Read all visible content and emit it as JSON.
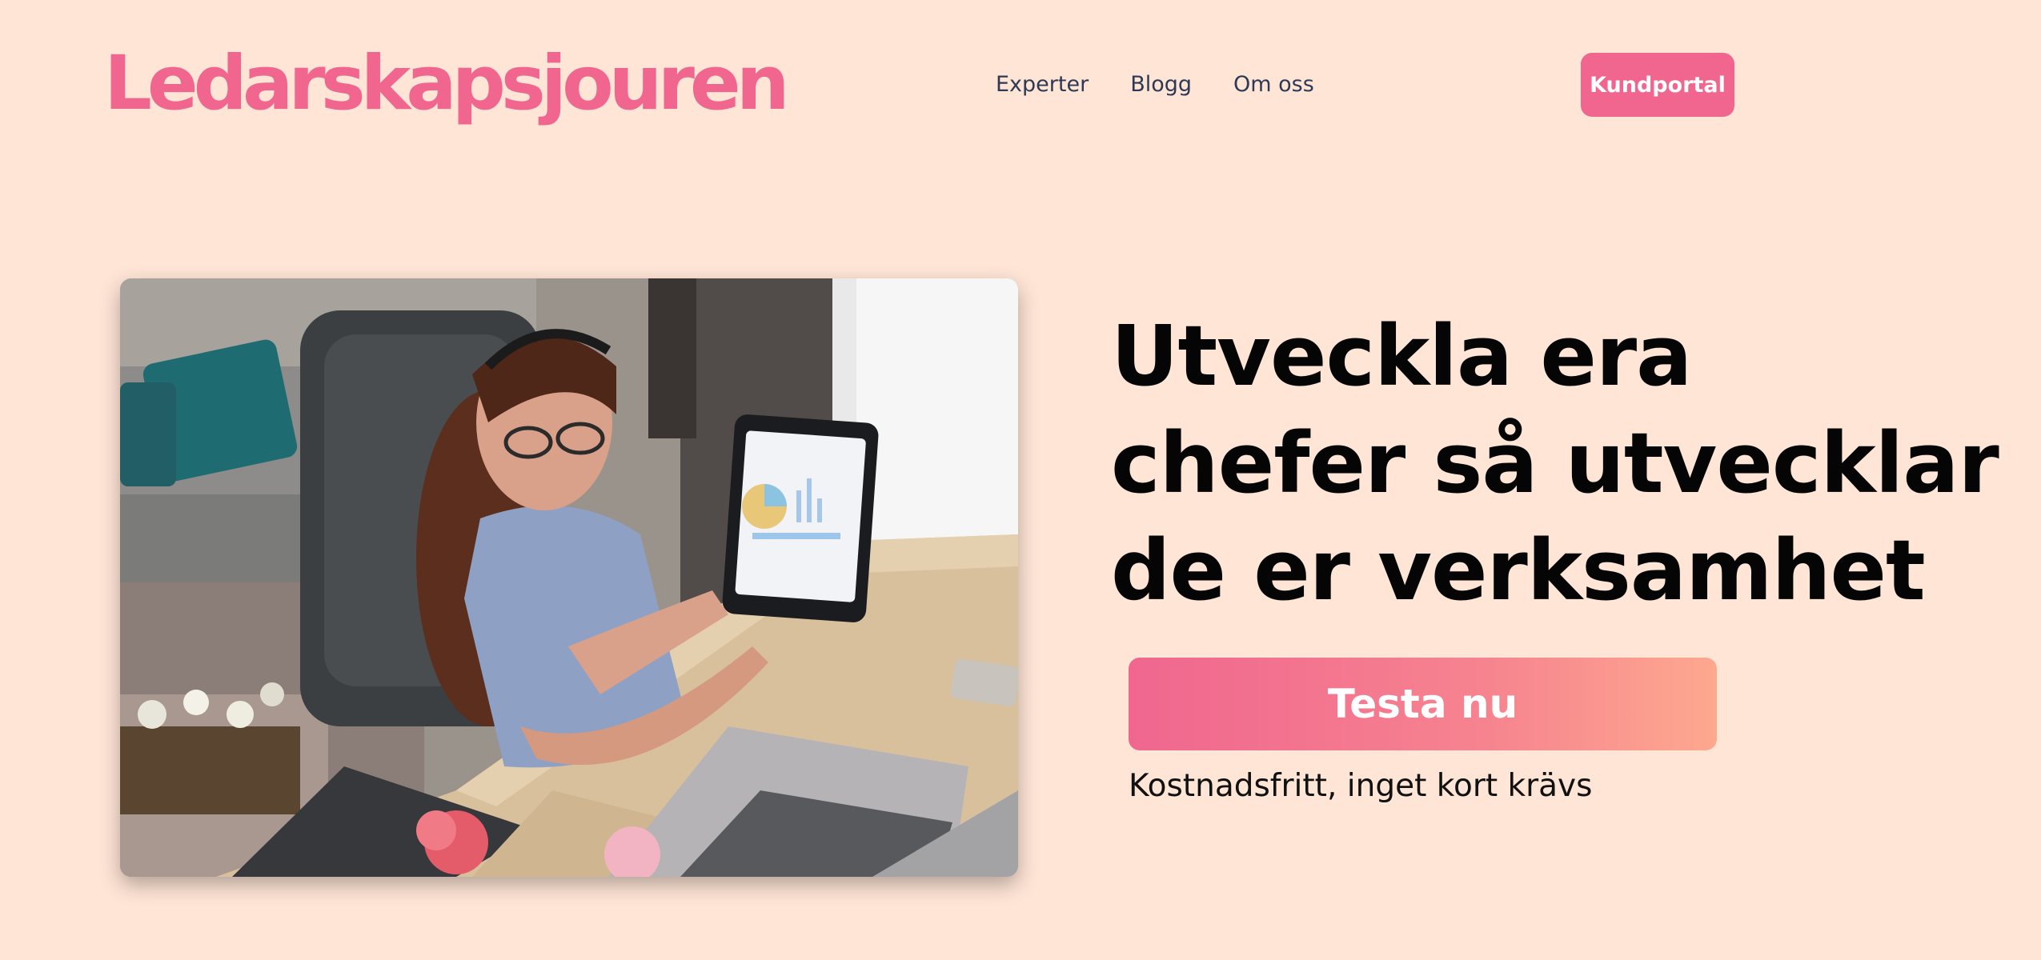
{
  "brand": {
    "logo_text": "Ledarskapsjouren",
    "accent_color": "#f0668f",
    "background_color": "#ffe5d6"
  },
  "nav": {
    "items": [
      {
        "label": "Experter"
      },
      {
        "label": "Blogg"
      },
      {
        "label": "Om oss"
      }
    ],
    "portal_button": "Kundportal"
  },
  "hero": {
    "image_alt": "Woman with headset pointing at a tablet showing charts at a desk with laptop and flowers",
    "headline": "Utveckla era chefer så utvecklar de er verksamhet",
    "cta_label": "Testa nu",
    "cta_note": "Kostnadsfritt, inget kort krävs"
  }
}
